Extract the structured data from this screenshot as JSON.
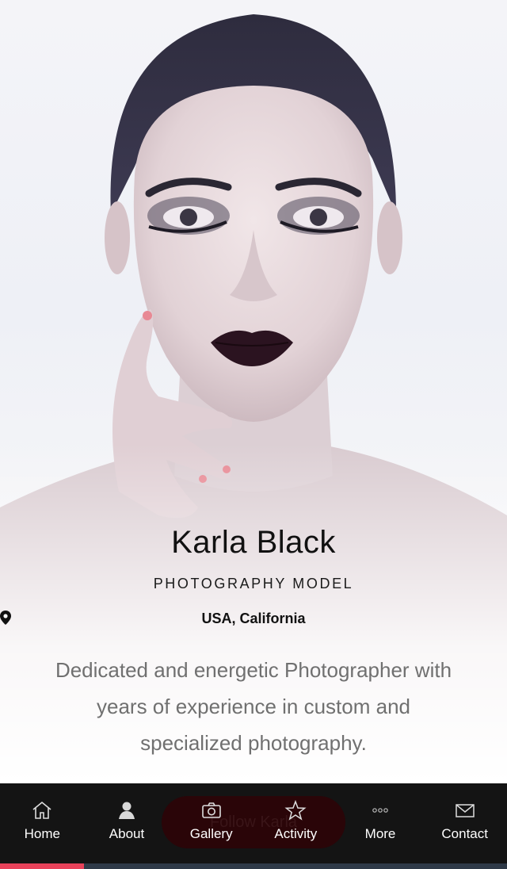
{
  "profile": {
    "name": "Karla Black",
    "role": "PHOTOGRAPHY MODEL",
    "location": "USA, California",
    "bio": "Dedicated and energetic Photographer with years of experience in custom and specialized photography."
  },
  "follow_button": {
    "label": "Follow Karla"
  },
  "nav": {
    "items": [
      {
        "label": "Home",
        "icon": "home-icon"
      },
      {
        "label": "About",
        "icon": "user-icon"
      },
      {
        "label": "Gallery",
        "icon": "camera-icon"
      },
      {
        "label": "Activity",
        "icon": "star-icon"
      },
      {
        "label": "More",
        "icon": "more-dots-icon"
      },
      {
        "label": "Contact",
        "icon": "envelope-icon"
      }
    ]
  },
  "progress": {
    "value": 0.165
  },
  "colors": {
    "accent": "#e8425a",
    "nav_background": "#141414",
    "follow_button_bg": "#2a0508"
  }
}
